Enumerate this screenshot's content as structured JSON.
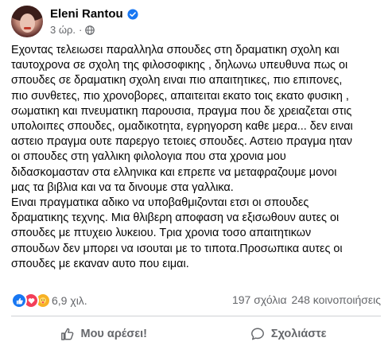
{
  "post": {
    "author": "Eleni Rantou",
    "time": "3 ώρ.",
    "lines": [
      "Εχοντας τελειωσει παραλληλα σπουδες στη δραματικη σχολη και",
      "ταυτοχρονα σε σχολη της φιλοσοφικης , δηλωνω υπευθυνα πως οι",
      "σπουδες σε δραματικη σχολη ειναι πιο απαιτητικες, πιο επιπονες,",
      "πιο συνθετες, πιο χρονοβορες, απαιτειται εκατο τοις εκατο φυσικη ,",
      "σωματικη και πνευματικη παρουσια, πραγμα που δε χρειαζεται στις",
      "υπολοιπες σπουδες, ομαδικοτητα, εγρηγορση καθε μερα... δεν ειναι",
      "αστειο πραγμα ουτε παρεργο τετοιες σπουδες. Αστειο πραγμα ηταν",
      "οι σπουδες στη γαλλικη φιλολογια που στα χρονια μου",
      "διδασκομασταν στα ελληνικα και επρεπε να μεταφραζουμε μονοι",
      "μας τα βιβλια και να τα δινουμε στα γαλλικα.",
      "Ειναι πραγματικα αδικο να υποβαθμιζονται ετσι οι σπουδες",
      "δραματικης τεχνης. Μια θλιβερη αποφαση να εξισωθουν αυτες οι",
      "σπουδες με  πτυχειο  λυκειου. Τρια χρονια τοσο απαιτητικων",
      "σπουδων δεν μπορει να ισουται με το τιποτα.Προσωπικα αυτες οι",
      "σπουδες με εκαναν αυτο που ειμαι."
    ],
    "reactions_count": "6,9 χιλ.",
    "comments": "197 σχόλια",
    "shares": "248 κοινοποιήσεις",
    "like_label": "Μου αρέσει!",
    "comment_label": "Σχολιάστε",
    "colors": {
      "accent": "#1877f2",
      "love": "#f33e58",
      "care": "#f7b125",
      "muted": "#65676b"
    },
    "icons": [
      "verified-badge-icon",
      "globe-icon",
      "like-reaction-icon",
      "love-reaction-icon",
      "care-reaction-icon",
      "thumbs-up-icon",
      "comment-bubble-icon"
    ]
  }
}
